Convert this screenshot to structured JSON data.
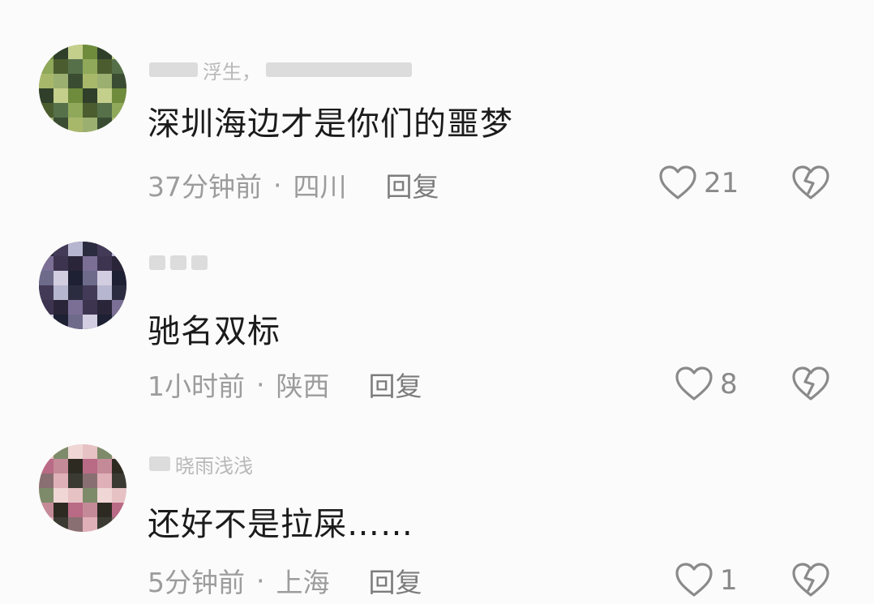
{
  "comments": [
    {
      "username": "浮生，",
      "text": "深圳海边才是你们的噩梦",
      "time": "37分钟前",
      "location": "四川",
      "reply_label": "回复",
      "likes": "21",
      "avatar_colors": [
        "#6f8b3c",
        "#a8b86a",
        "#4b5c2f",
        "#c4cf8c",
        "#3a4d33",
        "#8fa85a",
        "#2f3f2a",
        "#9bb070",
        "#56704a"
      ]
    },
    {
      "username": "",
      "text": "驰名双标",
      "time": "1小时前",
      "location": "陕西",
      "reply_label": "回复",
      "likes": "8",
      "avatar_colors": [
        "#2b2c3f",
        "#6d6a8a",
        "#3d3450",
        "#b7b6d0",
        "#1e2033",
        "#7c6f95",
        "#433a58",
        "#d2cde0",
        "#2a2538"
      ]
    },
    {
      "username": "晓雨浅浅",
      "text": "还好不是拉屎……",
      "time": "5分钟前",
      "location": "上海",
      "reply_label": "回复",
      "likes": "1",
      "avatar_colors": [
        "#e7c2c4",
        "#8a6f72",
        "#c58a98",
        "#f0d6d5",
        "#3b3a32",
        "#b96a85",
        "#7d8b6a",
        "#e0b0b8",
        "#2d2a22"
      ]
    }
  ],
  "colors": {
    "text": "#1b1b1b",
    "meta": "#9c9c9c",
    "icon": "#8a8a8a"
  }
}
